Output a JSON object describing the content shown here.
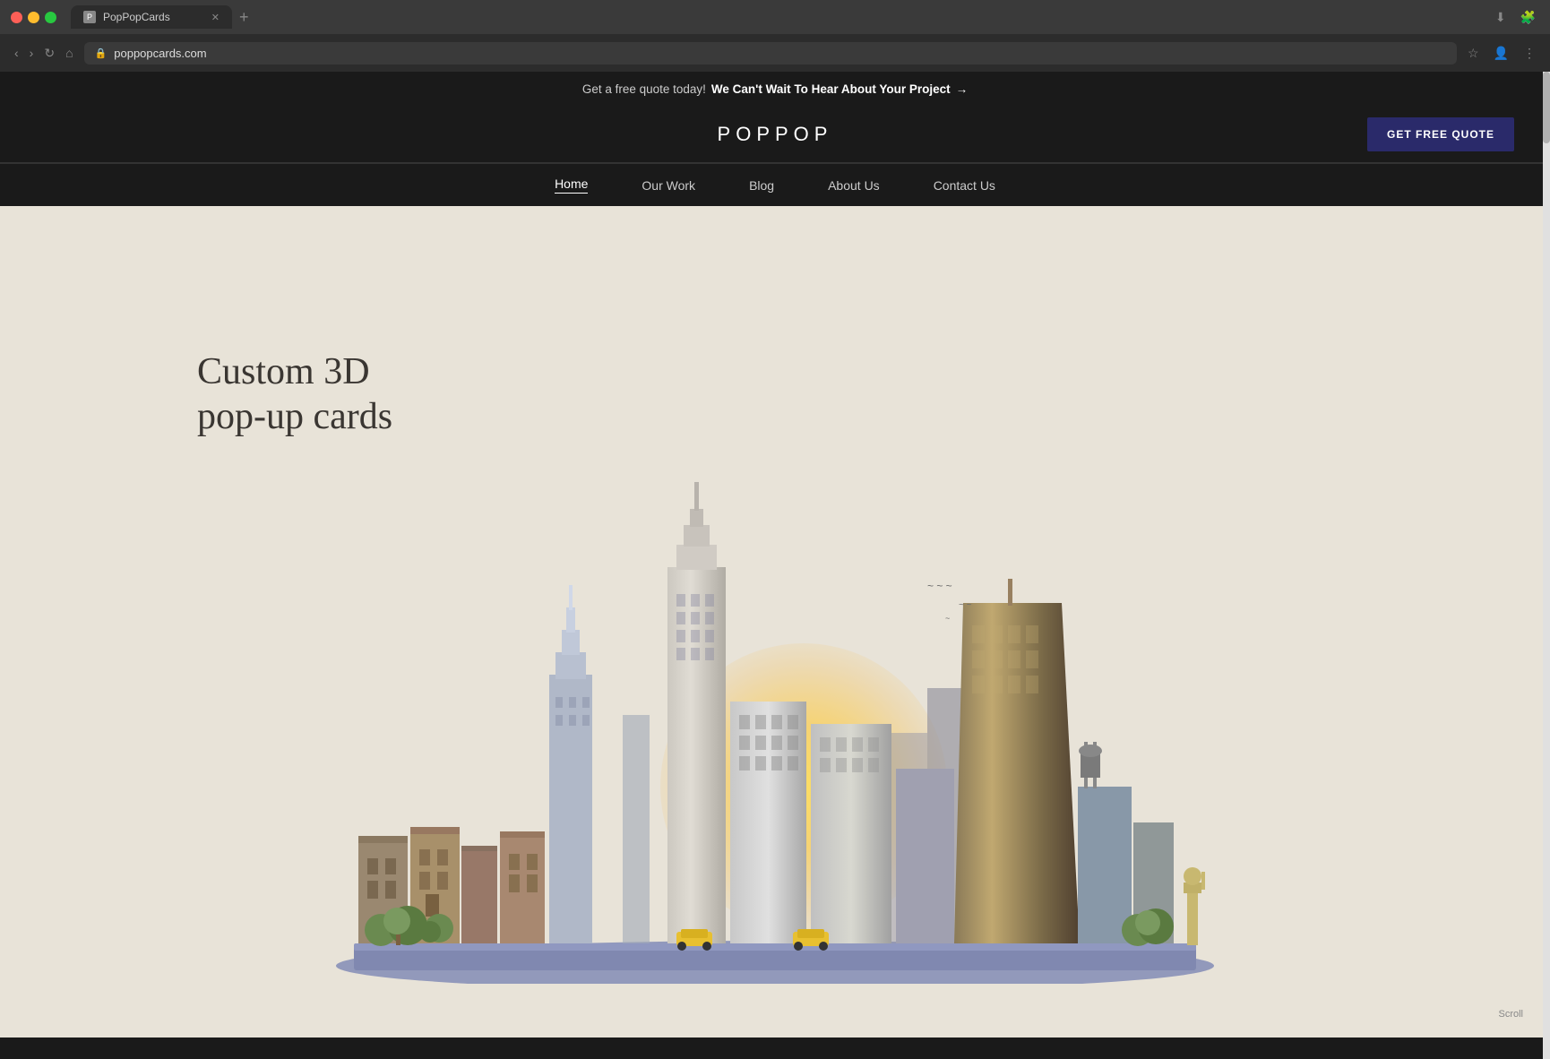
{
  "browser": {
    "tab_title": "PopPopCards",
    "url": "poppopcards.com",
    "favicon_label": "P",
    "new_tab_icon": "+",
    "nav_back": "‹",
    "nav_forward": "›",
    "nav_refresh": "↻",
    "nav_home": "⌂"
  },
  "announcement": {
    "normal_text": "Get a free quote today!",
    "bold_text": "We Can't Wait To Hear About Your Project",
    "arrow": "→"
  },
  "header": {
    "logo": "POPPOP",
    "cta_button": "GET FREE QUOTE"
  },
  "nav": {
    "items": [
      {
        "label": "Home",
        "active": true
      },
      {
        "label": "Our Work",
        "active": false
      },
      {
        "label": "Blog",
        "active": false
      },
      {
        "label": "About Us",
        "active": false
      },
      {
        "label": "Contact Us",
        "active": false
      }
    ]
  },
  "hero": {
    "title_line1": "Custom 3D",
    "title_line2": "pop-up cards"
  },
  "scroll_indicator": "Scroll"
}
